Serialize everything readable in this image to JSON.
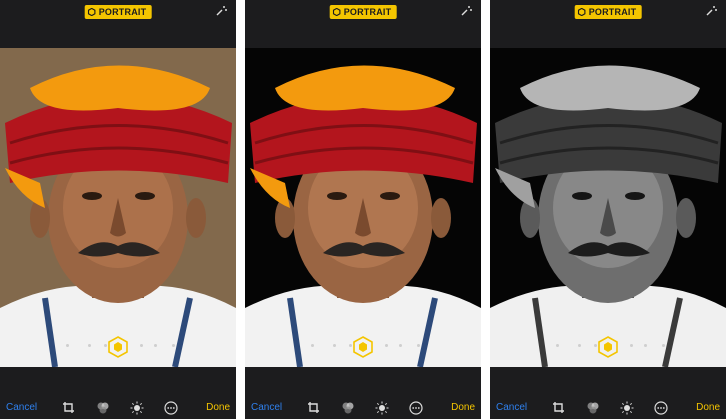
{
  "panels": [
    {
      "badge": "PORTRAIT",
      "cancel": "Cancel",
      "done": "Done",
      "mode": "color-soft",
      "icons": [
        "crop-rotate-icon",
        "filters-icon",
        "adjust-icon",
        "more-icon"
      ]
    },
    {
      "badge": "PORTRAIT",
      "cancel": "Cancel",
      "done": "Done",
      "mode": "color-stage",
      "icons": [
        "crop-rotate-icon",
        "filters-icon",
        "adjust-icon",
        "more-icon"
      ]
    },
    {
      "badge": "PORTRAIT",
      "cancel": "Cancel",
      "done": "Done",
      "mode": "mono-stage",
      "icons": [
        "crop-rotate-icon",
        "filters-icon",
        "adjust-icon",
        "more-icon"
      ]
    }
  ],
  "colors": {
    "accent_yellow": "#f4c500",
    "cancel_blue": "#2f80ed",
    "bar": "#1c1c1e"
  }
}
